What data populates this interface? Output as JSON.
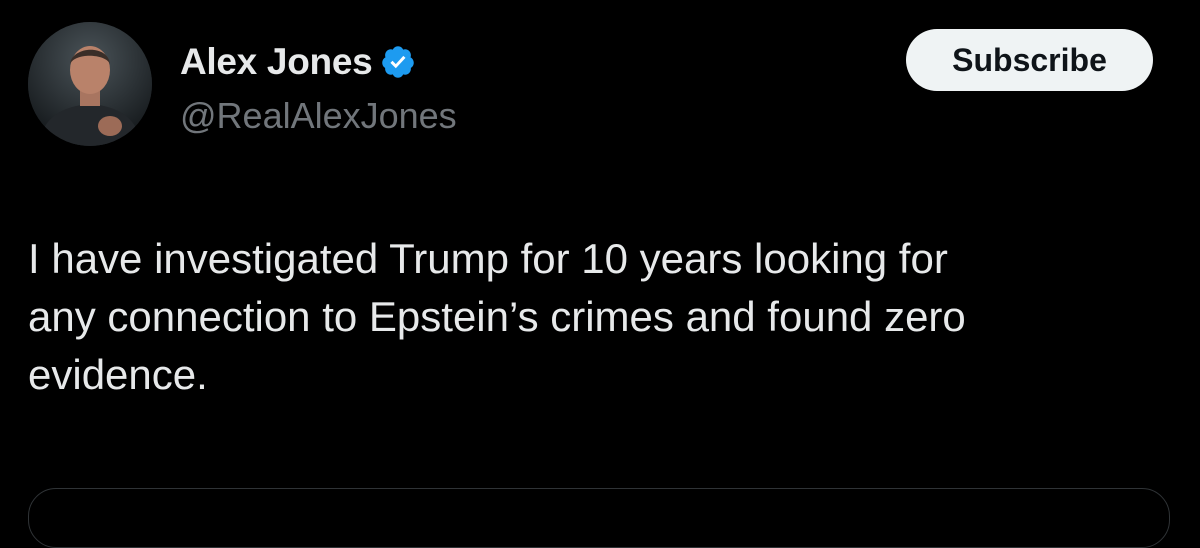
{
  "author": {
    "display_name": "Alex Jones",
    "handle": "@RealAlexJones",
    "verified": true
  },
  "actions": {
    "subscribe_label": "Subscribe"
  },
  "tweet": {
    "text": "I have investigated Trump for 10 years looking for\nany connection to Epstein’s crimes and found zero\nevidence."
  },
  "colors": {
    "background": "#000000",
    "primary_text": "#e7e9ea",
    "secondary_text": "#71767b",
    "verified_blue": "#1d9bf0",
    "button_bg": "#eff3f4",
    "button_text": "#0f1419",
    "border": "#2f3336"
  },
  "icons": {
    "verified": "verified-badge-icon"
  }
}
